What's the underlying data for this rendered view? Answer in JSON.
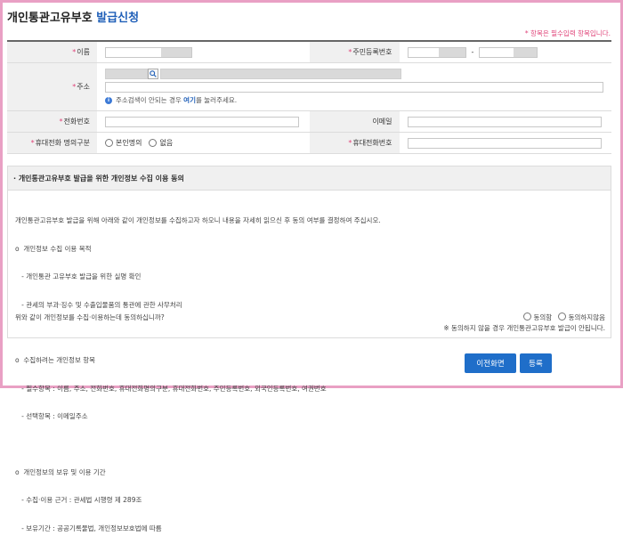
{
  "title": {
    "main": "개인통관고유부호",
    "accent": "발급신청"
  },
  "required_note": "* 항목은 필수입력 항목입니다.",
  "fields": {
    "name_label": "이름",
    "rrn_label": "주민등록번호",
    "rrn_separator": "-",
    "address_label": "주소",
    "address_help_prefix": "주소검색이 안되는 경우",
    "address_help_link": "여기",
    "address_help_suffix": "를 눌러주세요.",
    "phone_label": "전화번호",
    "email_label": "이메일",
    "mobile_owner_label": "휴대전화 명의구분",
    "mobile_owner_options": [
      "본인명의",
      "없음"
    ],
    "mobile_label": "휴대전화번호"
  },
  "consent": {
    "heading": "· 개인통관고유부호 발급을 위한 개인정보 수집 이용 동의",
    "intro": "개인통관고유부호 발급을 위해 아래와 같이 개인정보를 수집하고자 하오니 내용을 자세히 읽으신 후 동의 여부를 결정하여 주십시오.",
    "purpose_title": "o  개인정보 수집 이용 목적",
    "purpose_lines": [
      "   - 개인통관 고유부호 발급을 위한 실명 확인",
      "   - 관세의 부과·징수 및 수출입물품의 통관에 관한 사무처리"
    ],
    "items_title": "o  수집하려는 개인정보 항목",
    "items_lines": [
      "   - 필수항목 : 이름, 주소, 전화번호, 휴대전화명의구분, 휴대전화번호, 주민등록번호, 외국인등록번호, 여권번호",
      "   - 선택항목 : 이메일주소"
    ],
    "retention_title": "o  개인정보의 보유 및 이용 기간",
    "retention_lines": [
      "   - 수집·이용 근거 : 관세법 시행령 제 289조",
      "   - 보유기간 : 공공기록물법, 개인정보보호법에 따름"
    ],
    "question": "위와 같이 개인정보를 수집·이용하는데 동의하십니까?",
    "agree_label": "동의함",
    "disagree_label": "동의하지않음",
    "warning": "※ 동의하지 않을 경우 개인통관고유부호 발급이 안됩니다."
  },
  "buttons": {
    "prev": "이전화면",
    "submit": "등록"
  }
}
